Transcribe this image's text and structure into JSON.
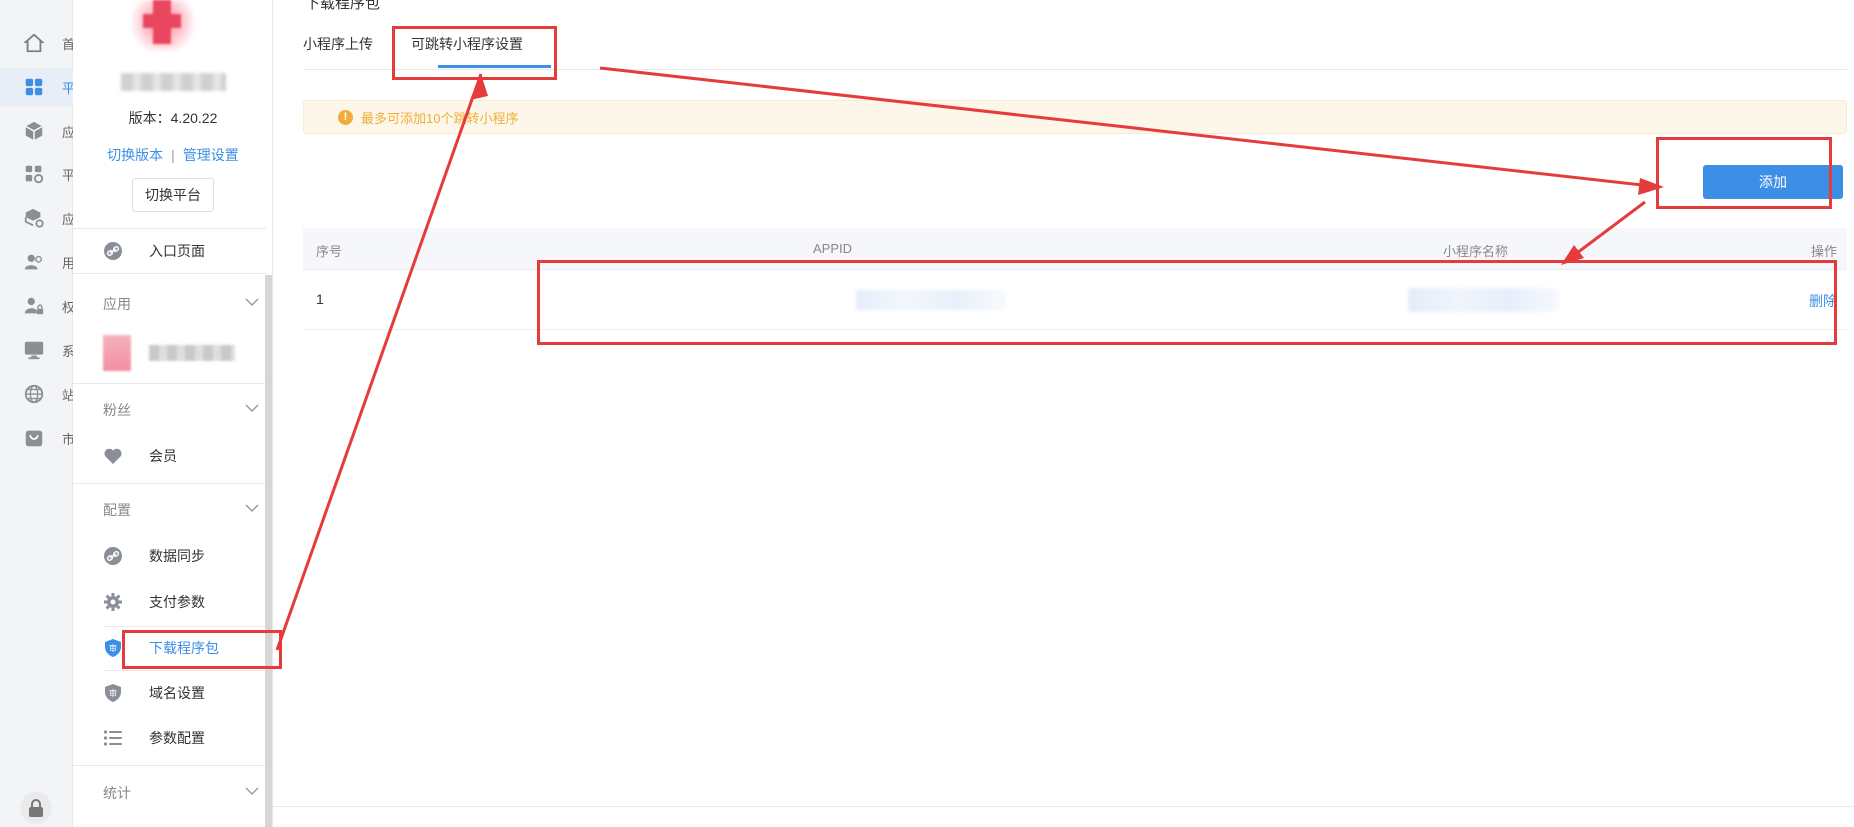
{
  "rail": {
    "items": [
      {
        "label": "首",
        "icon": "home-icon",
        "active": false
      },
      {
        "label": "平",
        "icon": "grid-icon",
        "active": true
      },
      {
        "label": "应",
        "icon": "cube-icon",
        "active": false
      },
      {
        "label": "平",
        "icon": "apps-settings-icon",
        "active": false
      },
      {
        "label": "应",
        "icon": "box-settings-icon",
        "active": false
      },
      {
        "label": "用",
        "icon": "users-icon",
        "active": false
      },
      {
        "label": "权",
        "icon": "user-lock-icon",
        "active": false
      },
      {
        "label": "系",
        "icon": "monitor-icon",
        "active": false
      },
      {
        "label": "站",
        "icon": "globe-icon",
        "active": false
      },
      {
        "label": "市",
        "icon": "shopping-bag-icon",
        "active": false
      }
    ],
    "bottom_icon": "lock-icon"
  },
  "sidebar": {
    "version": "版本：4.20.22",
    "switch_version": "切换版本",
    "separator": "|",
    "manage_settings": "管理设置",
    "switch_platform": "切换平台",
    "entry_page": "入口页面",
    "group_app": "应用",
    "group_fans": "粉丝",
    "member": "会员",
    "group_config": "配置",
    "data_sync": "数据同步",
    "pay_params": "支付参数",
    "download_package": "下载程序包",
    "domain_settings": "域名设置",
    "param_config": "参数配置",
    "group_stats": "统计"
  },
  "main": {
    "page_title": "下载程序包",
    "tabs": [
      {
        "label": "小程序上传",
        "active": false
      },
      {
        "label": "可跳转小程序设置",
        "active": true
      }
    ],
    "notice": "最多可添加10个跳转小程序",
    "add_button": "添加",
    "table": {
      "columns": [
        "序号",
        "APPID",
        "小程序名称",
        "操作"
      ],
      "rows": [
        {
          "index": "1",
          "appid": "",
          "name": "",
          "action": "删除"
        }
      ]
    }
  },
  "colors": {
    "accent": "#3d8ee6",
    "warning": "#f0ad3a",
    "annotation": "#e63b3b"
  }
}
